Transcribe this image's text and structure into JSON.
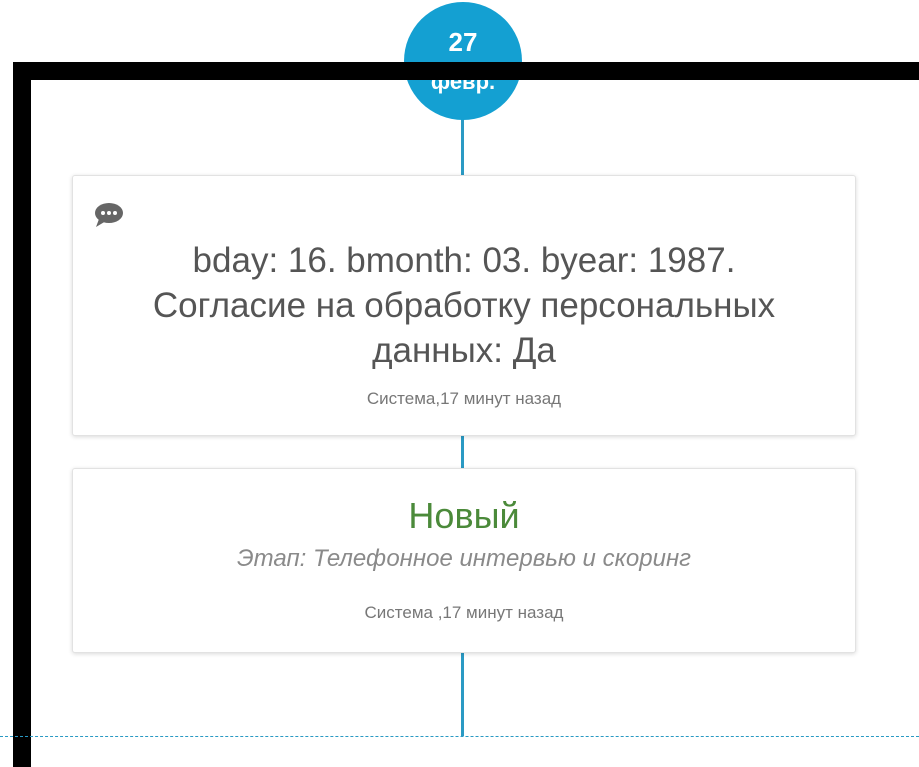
{
  "date": {
    "day": "27",
    "month": "февр."
  },
  "entries": [
    {
      "icon": "comment-icon",
      "message": "bday: 16. bmonth: 03. byear: 1987. Согласие на обработку персональных данных: Да",
      "meta": "Система,17 минут назад"
    },
    {
      "status": "Новый",
      "stage": "Этап: Телефонное интервью и скоринг",
      "meta": "Система ,17 минут назад"
    }
  ],
  "colors": {
    "accent": "#14a0d2",
    "timeline": "#2a9ac4",
    "status_green": "#4b8a3a",
    "frame": "#000000"
  }
}
